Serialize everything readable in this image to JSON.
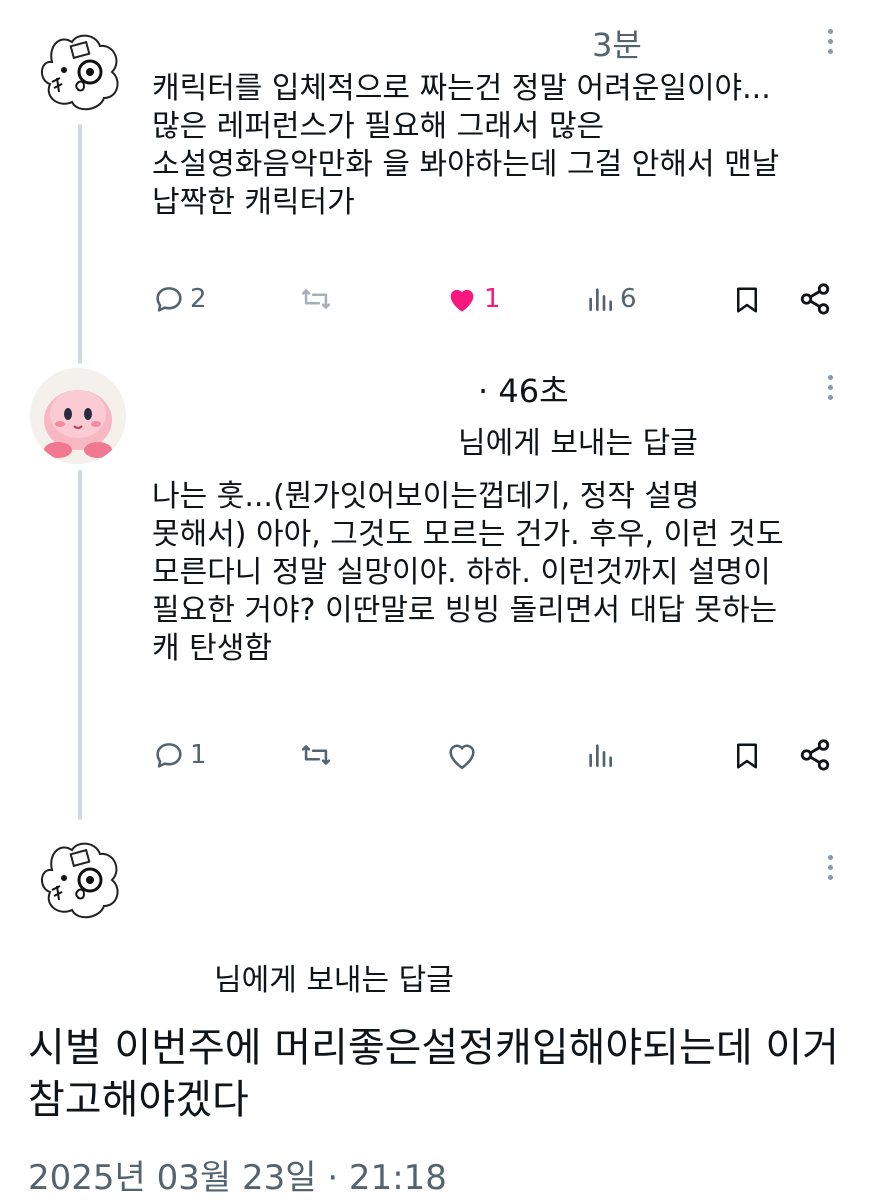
{
  "posts": [
    {
      "time": "3분",
      "text": "캐릭터를 입체적으로 짜는건 정말 어려운일이야...\n많은 레퍼런스가 필요해 그래서 많은\n소설영화음악만화 을 봐야하는데 그걸 안해서 맨날\n납짝한 캐릭터가",
      "actions": {
        "replies": "2",
        "reposts": "",
        "likes": "1",
        "views": "6"
      }
    },
    {
      "time": "· 46초",
      "reply_to": "님에게 보내는 답글",
      "text": "나는 훗...(뭔가잇어보이는껍데기, 정작 설명\n못해서) 아아, 그것도 모르는 건가. 후우, 이런 것도\n모른다니 정말 실망이야. 하하. 이런것까지 설명이\n필요한 거야? 이딴말로 빙빙 돌리면서 대답 못하는\n캐 탄생함",
      "actions": {
        "replies": "1",
        "reposts": "",
        "likes": "",
        "views": ""
      }
    },
    {
      "reply_to": "님에게 보내는 답글",
      "text": "시벌 이번주에 머리좋은설정캐입해야되는데 이거\n참고해야겠다",
      "date": "2025년 03월 23일 · 21:18"
    }
  ],
  "colors": {
    "accent_like": "#f91880",
    "muted": "#536471",
    "thread": "#cfd9de"
  }
}
